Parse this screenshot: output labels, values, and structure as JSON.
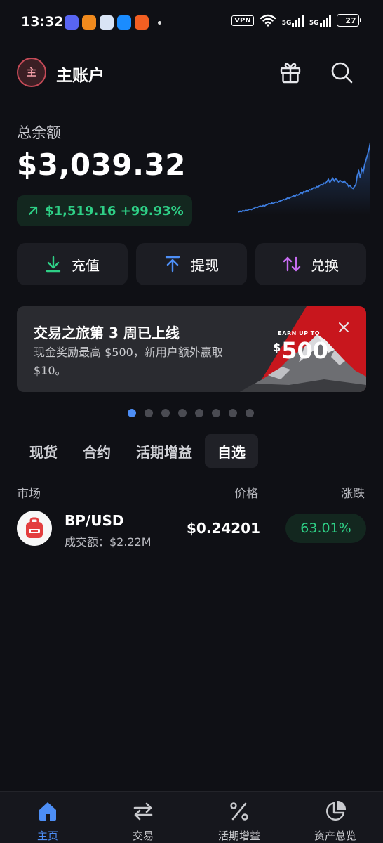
{
  "status_bar": {
    "time": "13:32",
    "vpn": "VPN",
    "signal1": "5G",
    "signal2": "5G",
    "battery": "27"
  },
  "header": {
    "avatar_text": "主",
    "account_name": "主账户",
    "gift_icon": "gift-icon",
    "search_icon": "search-icon"
  },
  "balance": {
    "label": "总余额",
    "value": "$3,039.32",
    "pnl": "$1,519.16 +99.93%",
    "trend_icon": "arrow-up-right-icon",
    "accent": "#2ecf86"
  },
  "sparkline": {
    "values": [
      38,
      40,
      39,
      41,
      40,
      42,
      41,
      43,
      44,
      43,
      45,
      46,
      48,
      47,
      49,
      50,
      49,
      51,
      50,
      52,
      53,
      55,
      54,
      56,
      55,
      57,
      58,
      57,
      59,
      60,
      61,
      63,
      62,
      64,
      66,
      65,
      67,
      68,
      70,
      69,
      72,
      71,
      73,
      76,
      74,
      78,
      77,
      80,
      79,
      82,
      81,
      84,
      86,
      85,
      88,
      87,
      90,
      92,
      91,
      95,
      94,
      98,
      102,
      96,
      100,
      104,
      99,
      103,
      101,
      97,
      100,
      98,
      96,
      99,
      95,
      93,
      88,
      90,
      86,
      84,
      88,
      92,
      110,
      118,
      105,
      122,
      116,
      130,
      140,
      150,
      160,
      175
    ],
    "line_color": "#3e7ee0"
  },
  "actions": [
    {
      "label": "充值",
      "icon": "download-icon",
      "color": "#2ecf86"
    },
    {
      "label": "提现",
      "icon": "upload-icon",
      "color": "#4d8ef5"
    },
    {
      "label": "兑换",
      "icon": "swap-icon",
      "color": "#c66cf0"
    }
  ],
  "banner": {
    "title": "交易之旅第 3 周已上线",
    "subtitle": "现金奖励最高 $500，新用户额外赢取 $10。",
    "earn_up_to": "EARN UP TO",
    "earn_currency": "$",
    "earn_amount": "500",
    "close_icon": "close-icon",
    "accent": "#c8161d"
  },
  "carousel": {
    "count": 8,
    "active_index": 0
  },
  "tabs": [
    {
      "label": "现货",
      "active": false
    },
    {
      "label": "合约",
      "active": false
    },
    {
      "label": "活期增益",
      "active": false
    },
    {
      "label": "自选",
      "active": true
    }
  ],
  "market_header": {
    "market": "市场",
    "price": "价格",
    "change": "涨跌"
  },
  "market_rows": [
    {
      "pair": "BP/USD",
      "volume": "成交额：$2.22M",
      "price": "$0.24201",
      "change": "63.01%",
      "icon": "backpack-icon",
      "icon_color": "#e33e3f"
    }
  ],
  "bottom_nav": [
    {
      "label": "主页",
      "icon": "home-icon",
      "active": true
    },
    {
      "label": "交易",
      "icon": "exchange-arrows-icon",
      "active": false
    },
    {
      "label": "活期增益",
      "icon": "percent-icon",
      "active": false
    },
    {
      "label": "资产总览",
      "icon": "pie-chart-icon",
      "active": false
    }
  ]
}
